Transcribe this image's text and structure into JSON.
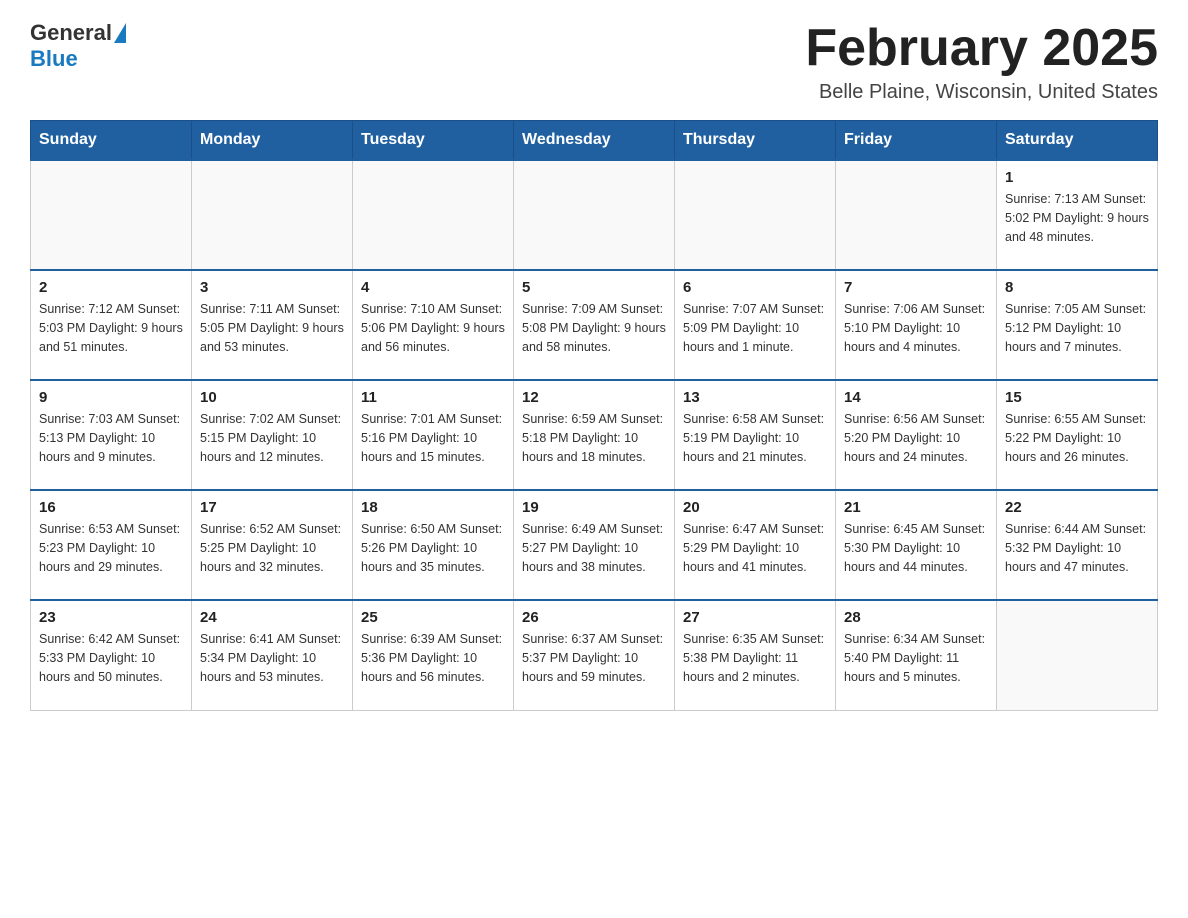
{
  "header": {
    "logo_general": "General",
    "logo_blue": "Blue",
    "title": "February 2025",
    "subtitle": "Belle Plaine, Wisconsin, United States"
  },
  "days_of_week": [
    "Sunday",
    "Monday",
    "Tuesday",
    "Wednesday",
    "Thursday",
    "Friday",
    "Saturday"
  ],
  "weeks": [
    [
      {
        "day": "",
        "info": ""
      },
      {
        "day": "",
        "info": ""
      },
      {
        "day": "",
        "info": ""
      },
      {
        "day": "",
        "info": ""
      },
      {
        "day": "",
        "info": ""
      },
      {
        "day": "",
        "info": ""
      },
      {
        "day": "1",
        "info": "Sunrise: 7:13 AM\nSunset: 5:02 PM\nDaylight: 9 hours\nand 48 minutes."
      }
    ],
    [
      {
        "day": "2",
        "info": "Sunrise: 7:12 AM\nSunset: 5:03 PM\nDaylight: 9 hours\nand 51 minutes."
      },
      {
        "day": "3",
        "info": "Sunrise: 7:11 AM\nSunset: 5:05 PM\nDaylight: 9 hours\nand 53 minutes."
      },
      {
        "day": "4",
        "info": "Sunrise: 7:10 AM\nSunset: 5:06 PM\nDaylight: 9 hours\nand 56 minutes."
      },
      {
        "day": "5",
        "info": "Sunrise: 7:09 AM\nSunset: 5:08 PM\nDaylight: 9 hours\nand 58 minutes."
      },
      {
        "day": "6",
        "info": "Sunrise: 7:07 AM\nSunset: 5:09 PM\nDaylight: 10 hours\nand 1 minute."
      },
      {
        "day": "7",
        "info": "Sunrise: 7:06 AM\nSunset: 5:10 PM\nDaylight: 10 hours\nand 4 minutes."
      },
      {
        "day": "8",
        "info": "Sunrise: 7:05 AM\nSunset: 5:12 PM\nDaylight: 10 hours\nand 7 minutes."
      }
    ],
    [
      {
        "day": "9",
        "info": "Sunrise: 7:03 AM\nSunset: 5:13 PM\nDaylight: 10 hours\nand 9 minutes."
      },
      {
        "day": "10",
        "info": "Sunrise: 7:02 AM\nSunset: 5:15 PM\nDaylight: 10 hours\nand 12 minutes."
      },
      {
        "day": "11",
        "info": "Sunrise: 7:01 AM\nSunset: 5:16 PM\nDaylight: 10 hours\nand 15 minutes."
      },
      {
        "day": "12",
        "info": "Sunrise: 6:59 AM\nSunset: 5:18 PM\nDaylight: 10 hours\nand 18 minutes."
      },
      {
        "day": "13",
        "info": "Sunrise: 6:58 AM\nSunset: 5:19 PM\nDaylight: 10 hours\nand 21 minutes."
      },
      {
        "day": "14",
        "info": "Sunrise: 6:56 AM\nSunset: 5:20 PM\nDaylight: 10 hours\nand 24 minutes."
      },
      {
        "day": "15",
        "info": "Sunrise: 6:55 AM\nSunset: 5:22 PM\nDaylight: 10 hours\nand 26 minutes."
      }
    ],
    [
      {
        "day": "16",
        "info": "Sunrise: 6:53 AM\nSunset: 5:23 PM\nDaylight: 10 hours\nand 29 minutes."
      },
      {
        "day": "17",
        "info": "Sunrise: 6:52 AM\nSunset: 5:25 PM\nDaylight: 10 hours\nand 32 minutes."
      },
      {
        "day": "18",
        "info": "Sunrise: 6:50 AM\nSunset: 5:26 PM\nDaylight: 10 hours\nand 35 minutes."
      },
      {
        "day": "19",
        "info": "Sunrise: 6:49 AM\nSunset: 5:27 PM\nDaylight: 10 hours\nand 38 minutes."
      },
      {
        "day": "20",
        "info": "Sunrise: 6:47 AM\nSunset: 5:29 PM\nDaylight: 10 hours\nand 41 minutes."
      },
      {
        "day": "21",
        "info": "Sunrise: 6:45 AM\nSunset: 5:30 PM\nDaylight: 10 hours\nand 44 minutes."
      },
      {
        "day": "22",
        "info": "Sunrise: 6:44 AM\nSunset: 5:32 PM\nDaylight: 10 hours\nand 47 minutes."
      }
    ],
    [
      {
        "day": "23",
        "info": "Sunrise: 6:42 AM\nSunset: 5:33 PM\nDaylight: 10 hours\nand 50 minutes."
      },
      {
        "day": "24",
        "info": "Sunrise: 6:41 AM\nSunset: 5:34 PM\nDaylight: 10 hours\nand 53 minutes."
      },
      {
        "day": "25",
        "info": "Sunrise: 6:39 AM\nSunset: 5:36 PM\nDaylight: 10 hours\nand 56 minutes."
      },
      {
        "day": "26",
        "info": "Sunrise: 6:37 AM\nSunset: 5:37 PM\nDaylight: 10 hours\nand 59 minutes."
      },
      {
        "day": "27",
        "info": "Sunrise: 6:35 AM\nSunset: 5:38 PM\nDaylight: 11 hours\nand 2 minutes."
      },
      {
        "day": "28",
        "info": "Sunrise: 6:34 AM\nSunset: 5:40 PM\nDaylight: 11 hours\nand 5 minutes."
      },
      {
        "day": "",
        "info": ""
      }
    ]
  ]
}
